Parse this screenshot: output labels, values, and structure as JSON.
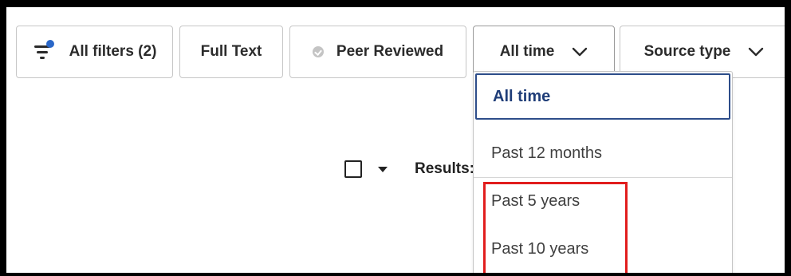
{
  "toolbar": {
    "all_filters_label": "All filters (2)",
    "full_text_label": "Full Text",
    "peer_reviewed_label": "Peer Reviewed",
    "time_filter_label": "All time",
    "source_type_label": "Source type"
  },
  "results": {
    "label": "Results:"
  },
  "time_dropdown": {
    "selected": "All time",
    "options": [
      "All time",
      "Past 12 months",
      "Past 5 years",
      "Past 10 years"
    ]
  },
  "colors": {
    "accent_dot": "#2a67c8",
    "selected_option": "#1f3d78",
    "highlight": "#e11d1d"
  },
  "icons": {
    "filter": "filter-icon",
    "verified": "check-circle-icon",
    "chevron": "chevron-down-icon",
    "caret": "caret-down-icon"
  }
}
